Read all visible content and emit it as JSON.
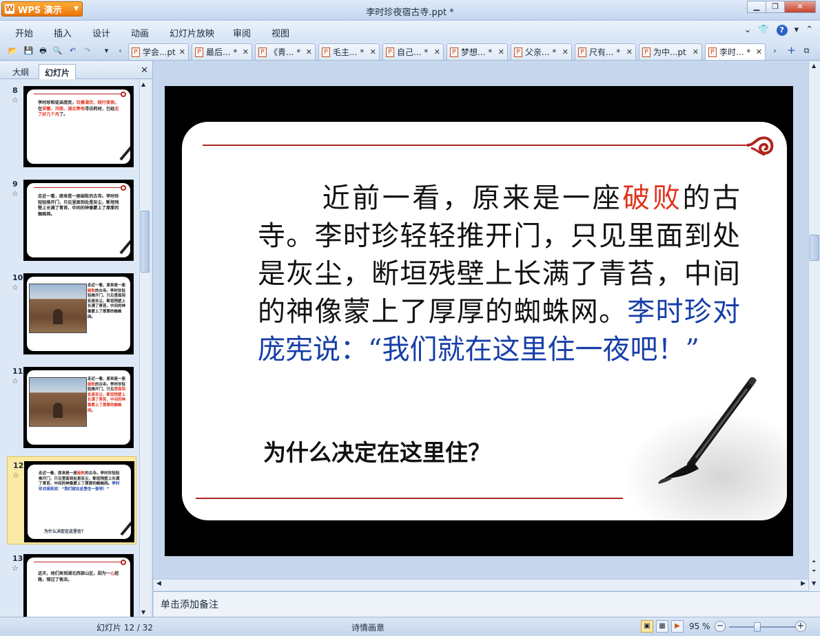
{
  "app": {
    "name": "WPS 演示",
    "logo_mark": "W"
  },
  "window": {
    "title": "李时珍夜宿古寺.ppt *"
  },
  "menu": {
    "items": [
      "开始",
      "插入",
      "设计",
      "动画",
      "幻灯片放映",
      "审阅",
      "视图"
    ]
  },
  "tabs": [
    {
      "label": "学会...pt",
      "active": false
    },
    {
      "label": "最后... *",
      "active": false
    },
    {
      "label": "《青... *",
      "active": false
    },
    {
      "label": "毛主... *",
      "active": false
    },
    {
      "label": "自己... *",
      "active": false
    },
    {
      "label": "梦想... *",
      "active": false
    },
    {
      "label": "父亲... *",
      "active": false
    },
    {
      "label": "尺有... *",
      "active": false
    },
    {
      "label": "为中...pt",
      "active": false
    },
    {
      "label": "李时... *",
      "active": true
    }
  ],
  "left_panel": {
    "tabs": [
      "大纲",
      "幻灯片"
    ],
    "active_tab": "幻灯片",
    "slides": [
      {
        "number": "8",
        "text_html": "李时珍和徒弟庞宪，<span class='r'>饥餐渴饮，晓行夜宿</span>，在<span class='r'>安徽、河南、湖北等地</span>寻访药材，已经<span class='r'>走了好几个月</span>了。"
      },
      {
        "number": "9",
        "text": "走近一看，原来是一座破败的古寺。李时珍轻轻推开门，只见里面到处是灰尘，断垣残壁上长满了青苔，中间的神像蒙上了厚厚的蜘蛛网。"
      },
      {
        "number": "10",
        "text_html": "走近一看，原来是一座<span class='r'>破败</span>的古寺。李时珍轻轻推开门，只见里面到处是灰尘，断垣残壁上长满了青苔，中间的神像蒙上了厚厚的蜘蛛网。",
        "has_photo": true
      },
      {
        "number": "11",
        "text_html": "走近一看，原来是一座<span class='r'>破败</span>的古寺。李时珍轻轻推开门，只见<span class='r'>里面到处是灰尘，断垣残壁上长满了青苔，中间的神像蒙上了厚厚的蜘蛛网</span>。",
        "has_photo": true
      },
      {
        "number": "12",
        "selected": true,
        "text_html": "走近一看，原来是一座<span class='r'>破败</span>的古寺。李时珍轻轻推开门，只见里面到处是灰尘，断垣残壁上长满了青苔，中间的神像蒙上了厚厚的蜘蛛网。<span class='b'>李时珍对庞宪说：“我们就在这里住一夜吧！”</span>",
        "question": "为什么决定在这里住？"
      },
      {
        "number": "13",
        "text_html": "这天，他们来到湖北西部山区，因为一<span class='r'>心</span>赶路，错过了客店。"
      }
    ]
  },
  "slide": {
    "indent_text": "近前一看，原来是一座",
    "red_text": "破败",
    "body_text": "的古寺。李时珍轻轻推开门，只见里面到处是灰尘，断垣残壁上长满了青苔，中间的神像蒙上了厚厚的蜘蛛网。",
    "blue_text": "李时珍对庞宪说：“我们就在这里住一夜吧！”",
    "question": "为什么决定在这里住？"
  },
  "notes": {
    "placeholder": "单击添加备注"
  },
  "status": {
    "slide_info": "幻灯片 12 / 32",
    "theme": "诗情画意",
    "zoom": "95 %"
  },
  "colors": {
    "accent_red": "#e2321c",
    "accent_blue": "#173ea8",
    "selection": "#fbeaa5"
  }
}
